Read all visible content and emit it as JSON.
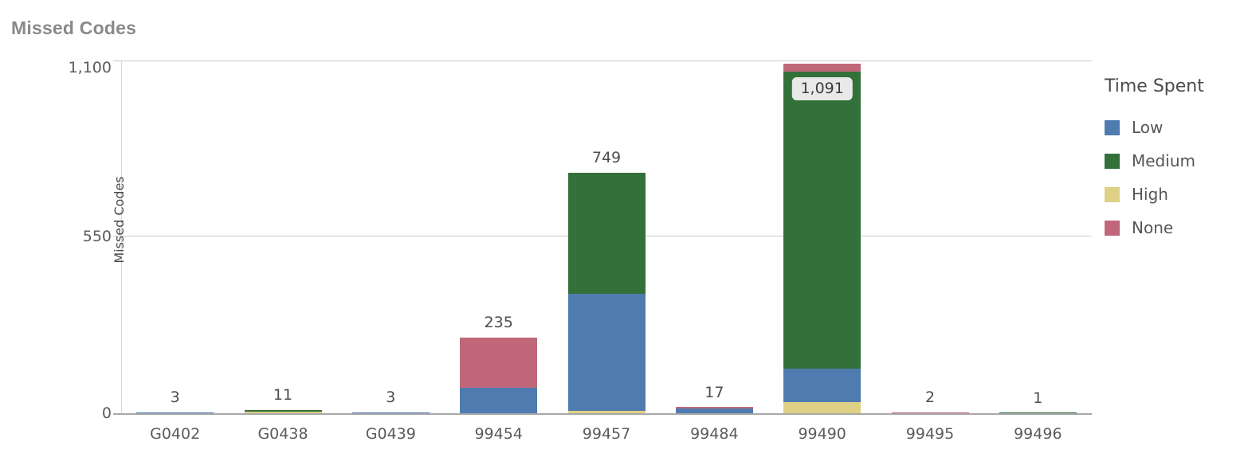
{
  "chart_data": {
    "type": "bar",
    "subtype": "stacked-bar",
    "title": "Missed Codes",
    "xlabel": "",
    "ylabel": "Missed Codes",
    "ylim": [
      0,
      1100
    ],
    "yticks": [
      "0",
      "550",
      "1,100"
    ],
    "ytick_values": [
      0,
      550,
      1100
    ],
    "grid": "horizontal",
    "legend_title": "Time Spent",
    "legend_position": "right",
    "categories": [
      "G0402",
      "G0438",
      "G0439",
      "99454",
      "99457",
      "99484",
      "99490",
      "99495",
      "99496"
    ],
    "series": [
      {
        "name": "Low",
        "color": "#4f7cb0",
        "values": [
          3,
          0,
          3,
          80,
          365,
          16,
          105,
          0,
          0
        ]
      },
      {
        "name": "Medium",
        "color": "#33703a",
        "values": [
          0,
          5,
          0,
          0,
          377,
          0,
          926,
          0,
          1
        ]
      },
      {
        "name": "High",
        "color": "#ded185",
        "values": [
          0,
          6,
          0,
          0,
          7,
          0,
          35,
          0,
          0
        ]
      },
      {
        "name": "None",
        "color": "#c0687a",
        "values": [
          0,
          0,
          0,
          155,
          0,
          1,
          25,
          2,
          0
        ]
      }
    ],
    "totals": [
      3,
      11,
      3,
      235,
      749,
      17,
      1091,
      2,
      1
    ],
    "total_labels": [
      "3",
      "11",
      "3",
      "235",
      "749",
      "17",
      "1,091",
      "2",
      "1"
    ],
    "highlighted_label_index": 6
  },
  "legend": {
    "title": "Time Spent",
    "items": [
      {
        "label": "Low",
        "color": "#4f7cb0"
      },
      {
        "label": "Medium",
        "color": "#33703a"
      },
      {
        "label": "High",
        "color": "#ded185"
      },
      {
        "label": "None",
        "color": "#c0687a"
      }
    ]
  },
  "axes": {
    "y_title": "Missed Codes",
    "y_ticks": [
      "1,100",
      "550",
      "0"
    ],
    "x_ticks": [
      "G0402",
      "G0438",
      "G0439",
      "99454",
      "99457",
      "99484",
      "99490",
      "99495",
      "99496"
    ]
  },
  "header": {
    "title": "Missed Codes"
  },
  "colors": {
    "title": "#898989",
    "tick_text": "#5b5b5b",
    "gridline": "#c9c9c9",
    "baseline": "#a8a8a8",
    "label_box_bg": "#e9e9e9",
    "background": "#ffffff"
  }
}
